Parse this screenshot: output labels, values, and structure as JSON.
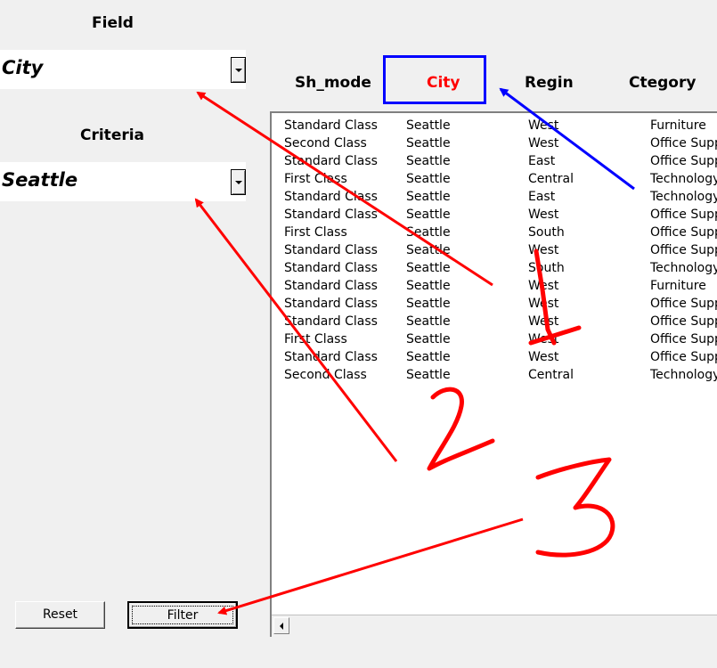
{
  "field": {
    "label": "Field",
    "value": "City"
  },
  "criteria": {
    "label": "Criteria",
    "value": "Seattle"
  },
  "headers": [
    "Sh_mode",
    "City",
    "Regin",
    "Ctegory"
  ],
  "rows": [
    [
      "Standard Class",
      "Seattle",
      "West",
      "Furniture"
    ],
    [
      "Second Class",
      "Seattle",
      "West",
      "Office Supp"
    ],
    [
      "Standard Class",
      "Seattle",
      "East",
      "Office Supp"
    ],
    [
      "First Class",
      "Seattle",
      "Central",
      "Technology"
    ],
    [
      "Standard Class",
      "Seattle",
      "East",
      "Technology"
    ],
    [
      "Standard Class",
      "Seattle",
      "West",
      "Office Supp"
    ],
    [
      "First Class",
      "Seattle",
      "South",
      "Office Supp"
    ],
    [
      "Standard Class",
      "Seattle",
      "West",
      "Office Supp"
    ],
    [
      "Standard Class",
      "Seattle",
      "South",
      "Technology"
    ],
    [
      "Standard Class",
      "Seattle",
      "West",
      "Furniture"
    ],
    [
      "Standard Class",
      "Seattle",
      "West",
      "Office Supp"
    ],
    [
      "Standard Class",
      "Seattle",
      "West",
      "Office Supp"
    ],
    [
      "First Class",
      "Seattle",
      "West",
      "Office Supp"
    ],
    [
      "Standard Class",
      "Seattle",
      "West",
      "Office Supp"
    ],
    [
      "Second Class",
      "Seattle",
      "Central",
      "Technology"
    ]
  ],
  "buttons": {
    "reset": "Reset",
    "filter": "Filter"
  },
  "annotations": [
    "1",
    "2",
    "3"
  ],
  "colors": {
    "highlight_header": "#ff0000",
    "highlight_box": "#0000ff",
    "annotation": "#ff0000"
  }
}
